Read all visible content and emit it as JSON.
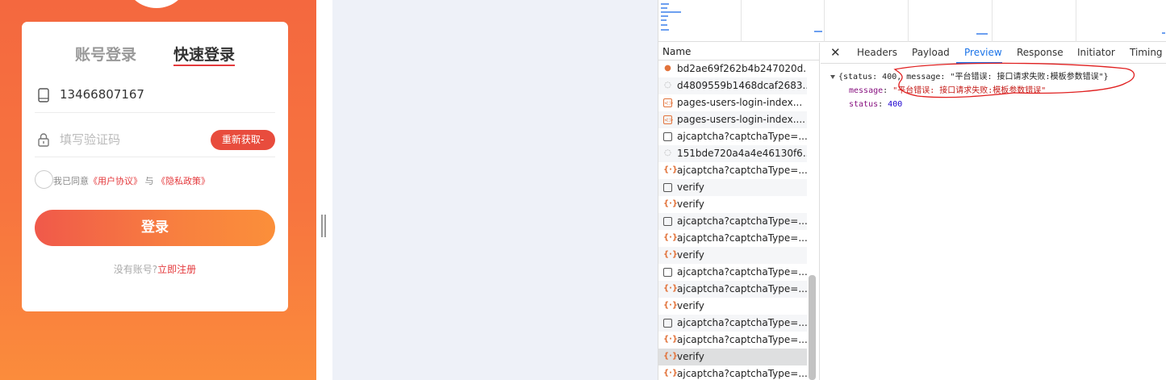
{
  "login": {
    "tab_password": "账号登录",
    "tab_quick": "快速登录",
    "phone_value": "13466807167",
    "code_placeholder": "填写验证码",
    "resend_label": "重新获取-",
    "agree_prefix": "我已同意",
    "user_agreement": "《用户协议》",
    "agree_and": "与",
    "privacy_policy": "《隐私政策》",
    "login_label": "登录",
    "no_account": "没有账号?",
    "register_now": "立即注册"
  },
  "devtools": {
    "list_header": "Name",
    "requests": [
      {
        "name": "bd2ae69f262b4b247020d...",
        "icon": "image-icon"
      },
      {
        "name": "d4809559b1468dcaf2683...",
        "icon": "generic-icon"
      },
      {
        "name": "pages-users-login-index...",
        "icon": "script-icon"
      },
      {
        "name": "pages-users-login-index....",
        "icon": "script-icon"
      },
      {
        "name": "ajcaptcha?captchaType=...",
        "icon": "document-icon"
      },
      {
        "name": "151bde720a4a4e46130f6...",
        "icon": "generic-icon"
      },
      {
        "name": "ajcaptcha?captchaType=...",
        "icon": "xhr-icon"
      },
      {
        "name": "verify",
        "icon": "document-icon"
      },
      {
        "name": "verify",
        "icon": "xhr-icon"
      },
      {
        "name": "ajcaptcha?captchaType=...",
        "icon": "document-icon"
      },
      {
        "name": "ajcaptcha?captchaType=...",
        "icon": "xhr-icon"
      },
      {
        "name": "verify",
        "icon": "xhr-icon"
      },
      {
        "name": "ajcaptcha?captchaType=...",
        "icon": "document-icon"
      },
      {
        "name": "ajcaptcha?captchaType=...",
        "icon": "xhr-icon"
      },
      {
        "name": "verify",
        "icon": "xhr-icon"
      },
      {
        "name": "ajcaptcha?captchaType=...",
        "icon": "document-icon"
      },
      {
        "name": "ajcaptcha?captchaType=...",
        "icon": "xhr-icon"
      },
      {
        "name": "verify",
        "icon": "xhr-icon"
      },
      {
        "name": "ajcaptcha?captchaType=...",
        "icon": "xhr-icon"
      }
    ],
    "selected_index": 17,
    "tabs": [
      "Headers",
      "Payload",
      "Preview",
      "Response",
      "Initiator",
      "Timing"
    ],
    "active_tab": "Preview",
    "preview": {
      "summary_open": "{status: 400, message: ",
      "summary_message": "\"平台错误: 接口请求失败:模板参数错误\"",
      "summary_close": "}",
      "message_key": "message",
      "message_value": "\"平台错误: 接口请求失败:模板参数错误\"",
      "status_key": "status",
      "status_value": "400"
    },
    "accent_color": "#1a73e8",
    "annotation_color": "#e02020"
  }
}
